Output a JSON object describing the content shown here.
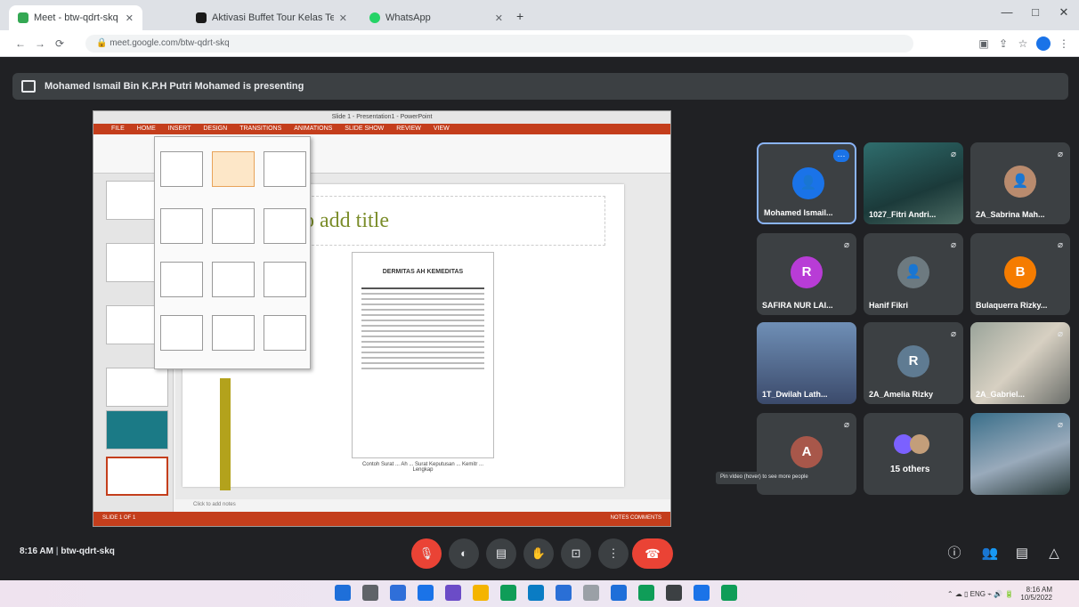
{
  "browser": {
    "tabs": [
      {
        "label": "Meet - btw-qdrt-skq",
        "color": "#34a853"
      },
      {
        "label": "Aktivasi Buffet Tour Kelas Terbuka",
        "color": "#1a1a1a"
      },
      {
        "label": "WhatsApp",
        "color": "#25d366"
      }
    ],
    "new_tab": "+",
    "url": "meet.google.com/btw-qdrt-skq",
    "window_controls": {
      "min": "—",
      "max": "□",
      "close": "✕"
    }
  },
  "meet": {
    "presenting_banner": "Mohamed Ismail Bin K.P.H Putri Mohamed is presenting",
    "time": "8:16 AM",
    "meeting_code": "btw-qdrt-skq",
    "tooltip": "Pin vIdeo (hover) to see more people",
    "participants": [
      {
        "name": "Mohamed Ismail...",
        "initial": "",
        "color": "#1a73e8",
        "kind": "avatar-photo"
      },
      {
        "name": "1027_Fitri Andri...",
        "initial": "",
        "color": "",
        "kind": "photo"
      },
      {
        "name": "2A_Sabrina Mah...",
        "initial": "",
        "color": "#b98b6e",
        "kind": "avatar-photo"
      },
      {
        "name": "SAFIRA NUR LAI...",
        "initial": "R",
        "color": "#b83cd6",
        "kind": "initial"
      },
      {
        "name": "Hanif Fikri",
        "initial": "",
        "color": "#6d7a80",
        "kind": "avatar-photo"
      },
      {
        "name": "Bulaquerra Rizky...",
        "initial": "B",
        "color": "#f57c00",
        "kind": "initial"
      },
      {
        "name": "1T_Dwilah Lath...",
        "initial": "",
        "color": "",
        "kind": "photo"
      },
      {
        "name": "2A_Amelia Rizky",
        "initial": "R",
        "color": "#5f7b92",
        "kind": "initial"
      },
      {
        "name": "2A_Gabriel...",
        "initial": "",
        "color": "",
        "kind": "photo"
      },
      {
        "name": "",
        "initial": "A",
        "color": "#a8574a",
        "kind": "initial"
      },
      {
        "name": "15 others",
        "initial": "",
        "color": "",
        "kind": "others"
      },
      {
        "name": "",
        "initial": "",
        "color": "",
        "kind": "photo"
      }
    ]
  },
  "presentation": {
    "window_title": "Slide 1 - Presentation1 - PowerPoint",
    "ribbon_tabs": [
      "FILE",
      "HOME",
      "INSERT",
      "DESIGN",
      "TRANSITIONS",
      "ANIMATIONS",
      "SLIDE SHOW",
      "REVIEW",
      "VIEW"
    ],
    "slide_title_placeholder": "o add title",
    "document_heading": "DERMITAS AH KEMEDITAS",
    "document_caption": "Contoh Surat ... Ah ... Surat Keputusan ... Kemitr ... Lengkap",
    "notes_placeholder": "Click to add notes",
    "status_left": "SLIDE 1 OF 1",
    "status_right": "NOTES  COMMENTS"
  },
  "controls": {
    "mic": "🎙",
    "camera": "◐",
    "captions": "▤",
    "raise_hand": "✋",
    "present": "⊡",
    "more": "⋮",
    "end_call": "☎",
    "info": "ⓘ",
    "people": "👥",
    "chat": "▤",
    "activities": "△"
  },
  "taskbar": {
    "apps": [
      "#1e6fd9",
      "#5f6368",
      "#2f6fd9",
      "#1a73e8",
      "#6b4cc7",
      "#f4b400",
      "#0f9d58",
      "#0a7cc4",
      "#2a6fd6",
      "#9aa0a6",
      "#1e6fd9",
      "#0f9d58",
      "#3c4043",
      "#1a73e8",
      "#0f9d58"
    ],
    "time": "8:16 AM",
    "date": "10/5/2022"
  },
  "colors": {
    "meet_bg": "#202124",
    "tile": "#3c4043",
    "red": "#ea4335",
    "ppt_accent": "#c43e1c"
  }
}
